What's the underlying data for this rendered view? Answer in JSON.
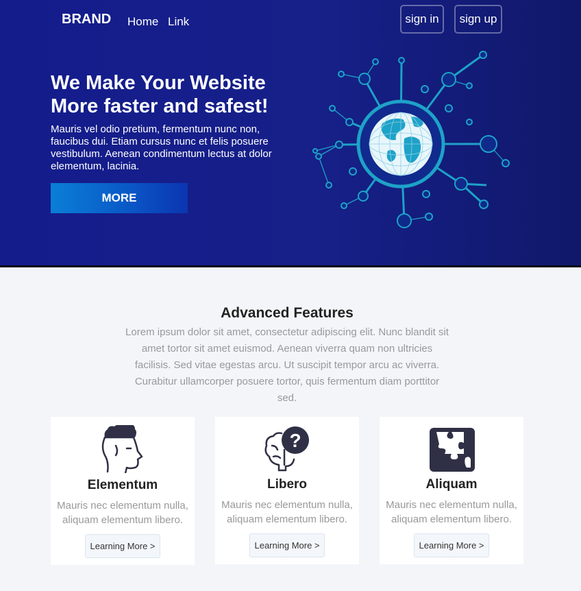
{
  "nav": {
    "brand": "BRAND",
    "links": [
      "Home",
      "Link"
    ],
    "sign_in": "sign in",
    "sign_up": "sign up"
  },
  "hero": {
    "title": "We Make Your Website More faster and safest!",
    "text": "Mauris vel odio pretium, fermentum nunc non, faucibus dui. Etiam cursus nunc et felis posuere vestibulum. Aenean condimentum lectus at dolor elementum, lacinia.",
    "button": "MORE"
  },
  "features": {
    "title": "Advanced Features",
    "text": "Lorem ipsum dolor sit amet, consectetur adipiscing elit. Nunc blandit sit amet tortor sit amet euismod. Aenean viverra quam non ultricies facilisis. Sed vitae egestas arcu. Ut suscipit tempor arcu ac viverra. Curabitur ullamcorper posuere tortor, quis fermentum diam porttitor sed.",
    "cards": [
      {
        "title": "Elementum",
        "text": "Mauris nec elementum nulla, aliquam elementum libero.",
        "button": "Learning More >",
        "icon": "head-icon"
      },
      {
        "title": "Libero",
        "text": "Mauris nec elementum nulla, aliquam elementum libero.",
        "button": "Learning More >",
        "icon": "brain-question-icon"
      },
      {
        "title": "Aliquam",
        "text": "Mauris nec elementum nulla, aliquam elementum libero.",
        "button": "Learning More >",
        "icon": "puzzle-icon"
      }
    ]
  },
  "colors": {
    "hero_bg": "#141c8c",
    "accent_blue": "#0a7fd6",
    "network_teal": "#1fa3c8",
    "icon_dark": "#2f3045"
  }
}
